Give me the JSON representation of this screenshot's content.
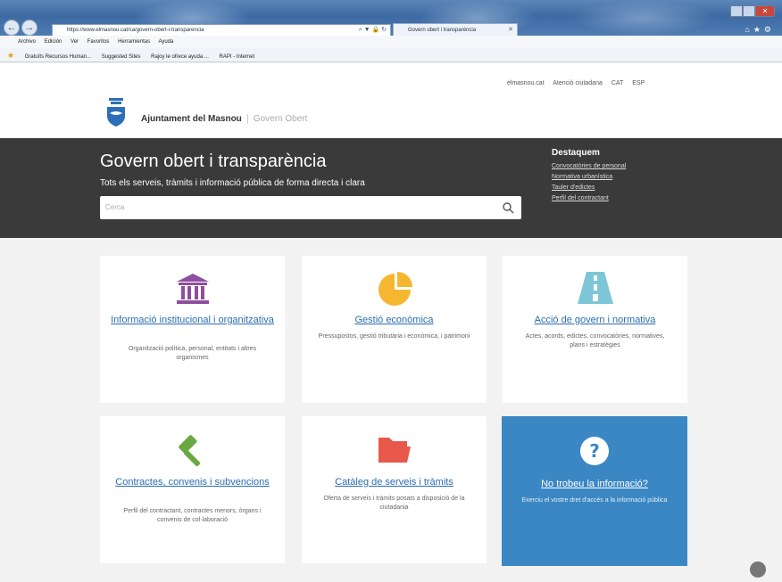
{
  "browser": {
    "address_url": "https://www.elmasnou.cat/ca/govern-obert-i-transparencia",
    "tab_title": "Govern obert i transparència",
    "menu": [
      "Archivo",
      "Edición",
      "Ver",
      "Favoritos",
      "Herramientas",
      "Ayuda"
    ],
    "favorites": [
      "Gratuïts Recursos Human...",
      "Suggested Sites",
      "Rajoy le ofrece ayuda ...",
      "RAPI - Internet"
    ]
  },
  "site": {
    "top_links": [
      "elmasnou.cat",
      "Atenció ciutadana",
      "CAT",
      "ESP"
    ],
    "brand": "Ajuntament del Masnou",
    "brand_sub": "Govern Obert"
  },
  "hero": {
    "title": "Govern obert i transparència",
    "subtitle": "Tots els serveis, tràmits i informació pública de forma directa i clara",
    "search_placeholder": "Cerca",
    "highlights_title": "Destaquem",
    "highlights": [
      "Convocatòries de personal",
      "Normativa urbanística",
      "Tauler d'edictes",
      "Perfil del contractant"
    ]
  },
  "cards": [
    {
      "title": "Informació institucional i organitzativa",
      "desc": "Organització política, personal, entitats i altres organismes",
      "color": "#8e4fa0",
      "icon": "institution-icon"
    },
    {
      "title": "Gestió econòmica",
      "desc": "Pressupostos, gestió tributària i econòmica, i patrimoni",
      "color": "#f5b731",
      "icon": "pie-chart-icon"
    },
    {
      "title": "Acció de govern i normativa",
      "desc": "Actes, acords, edictes, convocatòries, normatives, plans i estratègies",
      "color": "#7dc6d8",
      "icon": "road-icon"
    },
    {
      "title": "Contractes, convenis i subvencions",
      "desc": "Perfil del contractant, contractes menors, òrgans i convenis de col·laboració",
      "color": "#6aa842",
      "icon": "gavel-icon"
    },
    {
      "title": "Catàleg de serveis i tràmits",
      "desc": "Oferta de serveis i tràmits posats a disposició de la ciutadania",
      "color": "#e8584a",
      "icon": "folder-icon"
    },
    {
      "title": "No trobeu la informació?",
      "desc": "Exerciu el vostre dret d'accés a la informació pública",
      "color": "#3b87c4",
      "icon": "question-icon"
    }
  ]
}
